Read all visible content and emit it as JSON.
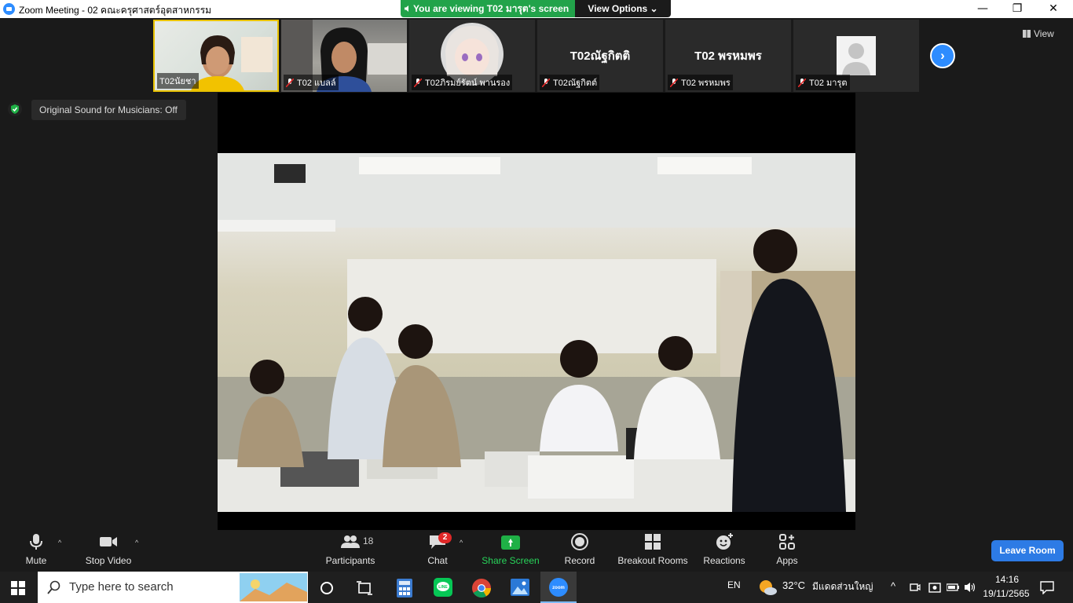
{
  "titlebar": {
    "title": "Zoom Meeting - 02 คณะครุศาสตร์อุตสาหกรรม",
    "viewing_banner": "You are viewing T02 มารุต's screen",
    "view_options": "View Options ⌄",
    "minimize": "—",
    "restore": "❐",
    "close": "✕"
  },
  "thumbnails": [
    {
      "name": "T02นัยชา",
      "type": "video",
      "muted": false,
      "active": true
    },
    {
      "name": "T02 แบลล์",
      "type": "video",
      "muted": true,
      "active": false
    },
    {
      "name": "T02ภิรมย์รัตน์ พานรอง",
      "type": "avatar",
      "muted": true,
      "active": false
    },
    {
      "name": "T02ณัฐกิตต์",
      "display": "T02ณัฐกิตติ",
      "type": "text",
      "muted": true,
      "active": false
    },
    {
      "name": "T02 พรหมพร",
      "display": "T02 พรหมพร",
      "type": "text",
      "muted": true,
      "active": false
    },
    {
      "name": "T02 มารุต",
      "type": "placeholder",
      "muted": true,
      "active": false
    }
  ],
  "view_button": "View",
  "original_sound": "Original Sound for Musicians: Off",
  "toolbar": {
    "mute": "Mute",
    "stop_video": "Stop Video",
    "participants": "Participants",
    "participants_count": "18",
    "chat": "Chat",
    "chat_badge": "2",
    "share_screen": "Share Screen",
    "record": "Record",
    "breakout_rooms": "Breakout Rooms",
    "reactions": "Reactions",
    "apps": "Apps",
    "leave_room": "Leave Room"
  },
  "taskbar": {
    "search_placeholder": "Type here to search",
    "language": "EN",
    "temperature": "32°C",
    "weather": "มีแดดส่วนใหญ่",
    "time": "14:16",
    "date": "19/11/2565"
  },
  "colors": {
    "active_border": "#e8c200",
    "banner_green": "#22a34a",
    "accent_blue": "#2d7be5",
    "share_green": "#1fb046"
  }
}
